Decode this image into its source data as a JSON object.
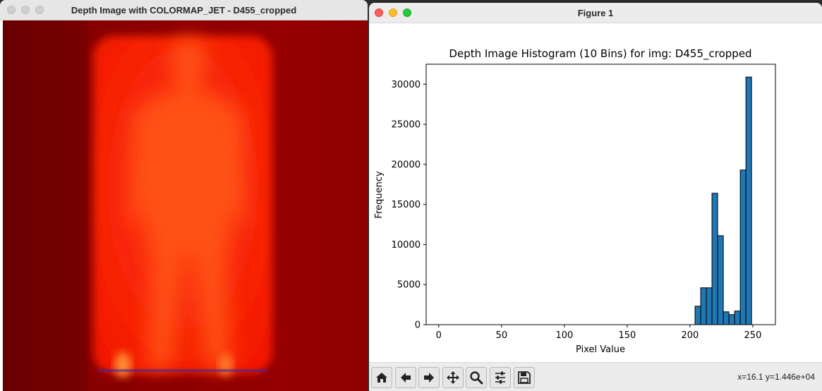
{
  "left_window": {
    "title": "Depth Image with COLORMAP_JET - D455_cropped"
  },
  "right_window": {
    "title": "Figure 1"
  },
  "toolbar": {
    "icons": [
      "home-icon",
      "back-arrow-icon",
      "forward-arrow-icon",
      "pan-move-icon",
      "zoom-magnifier-icon",
      "configure-subplots-icon",
      "save-disk-icon"
    ],
    "coords": "x=16.1 y=1.446e+04"
  },
  "chart_data": {
    "type": "bar",
    "title": "Depth Image Histogram (10 Bins) for img: D455_cropped",
    "xlabel": "Pixel Value",
    "ylabel": "Frequency",
    "xlim": [
      -10,
      268
    ],
    "ylim": [
      0,
      32500
    ],
    "xticks": [
      "0",
      "50",
      "100",
      "150",
      "200",
      "250"
    ],
    "yticks": [
      "0",
      "5000",
      "10000",
      "15000",
      "20000",
      "25000",
      "30000"
    ],
    "bar_color": "#1f77b4",
    "bin_edges": [
      204,
      208.5,
      213,
      217.5,
      222,
      226.5,
      231,
      235.5,
      240,
      244.5,
      249,
      253.5
    ],
    "values": [
      2300,
      4600,
      4600,
      16400,
      11100,
      1600,
      1250,
      1700,
      19300,
      30900
    ],
    "grid": false
  }
}
